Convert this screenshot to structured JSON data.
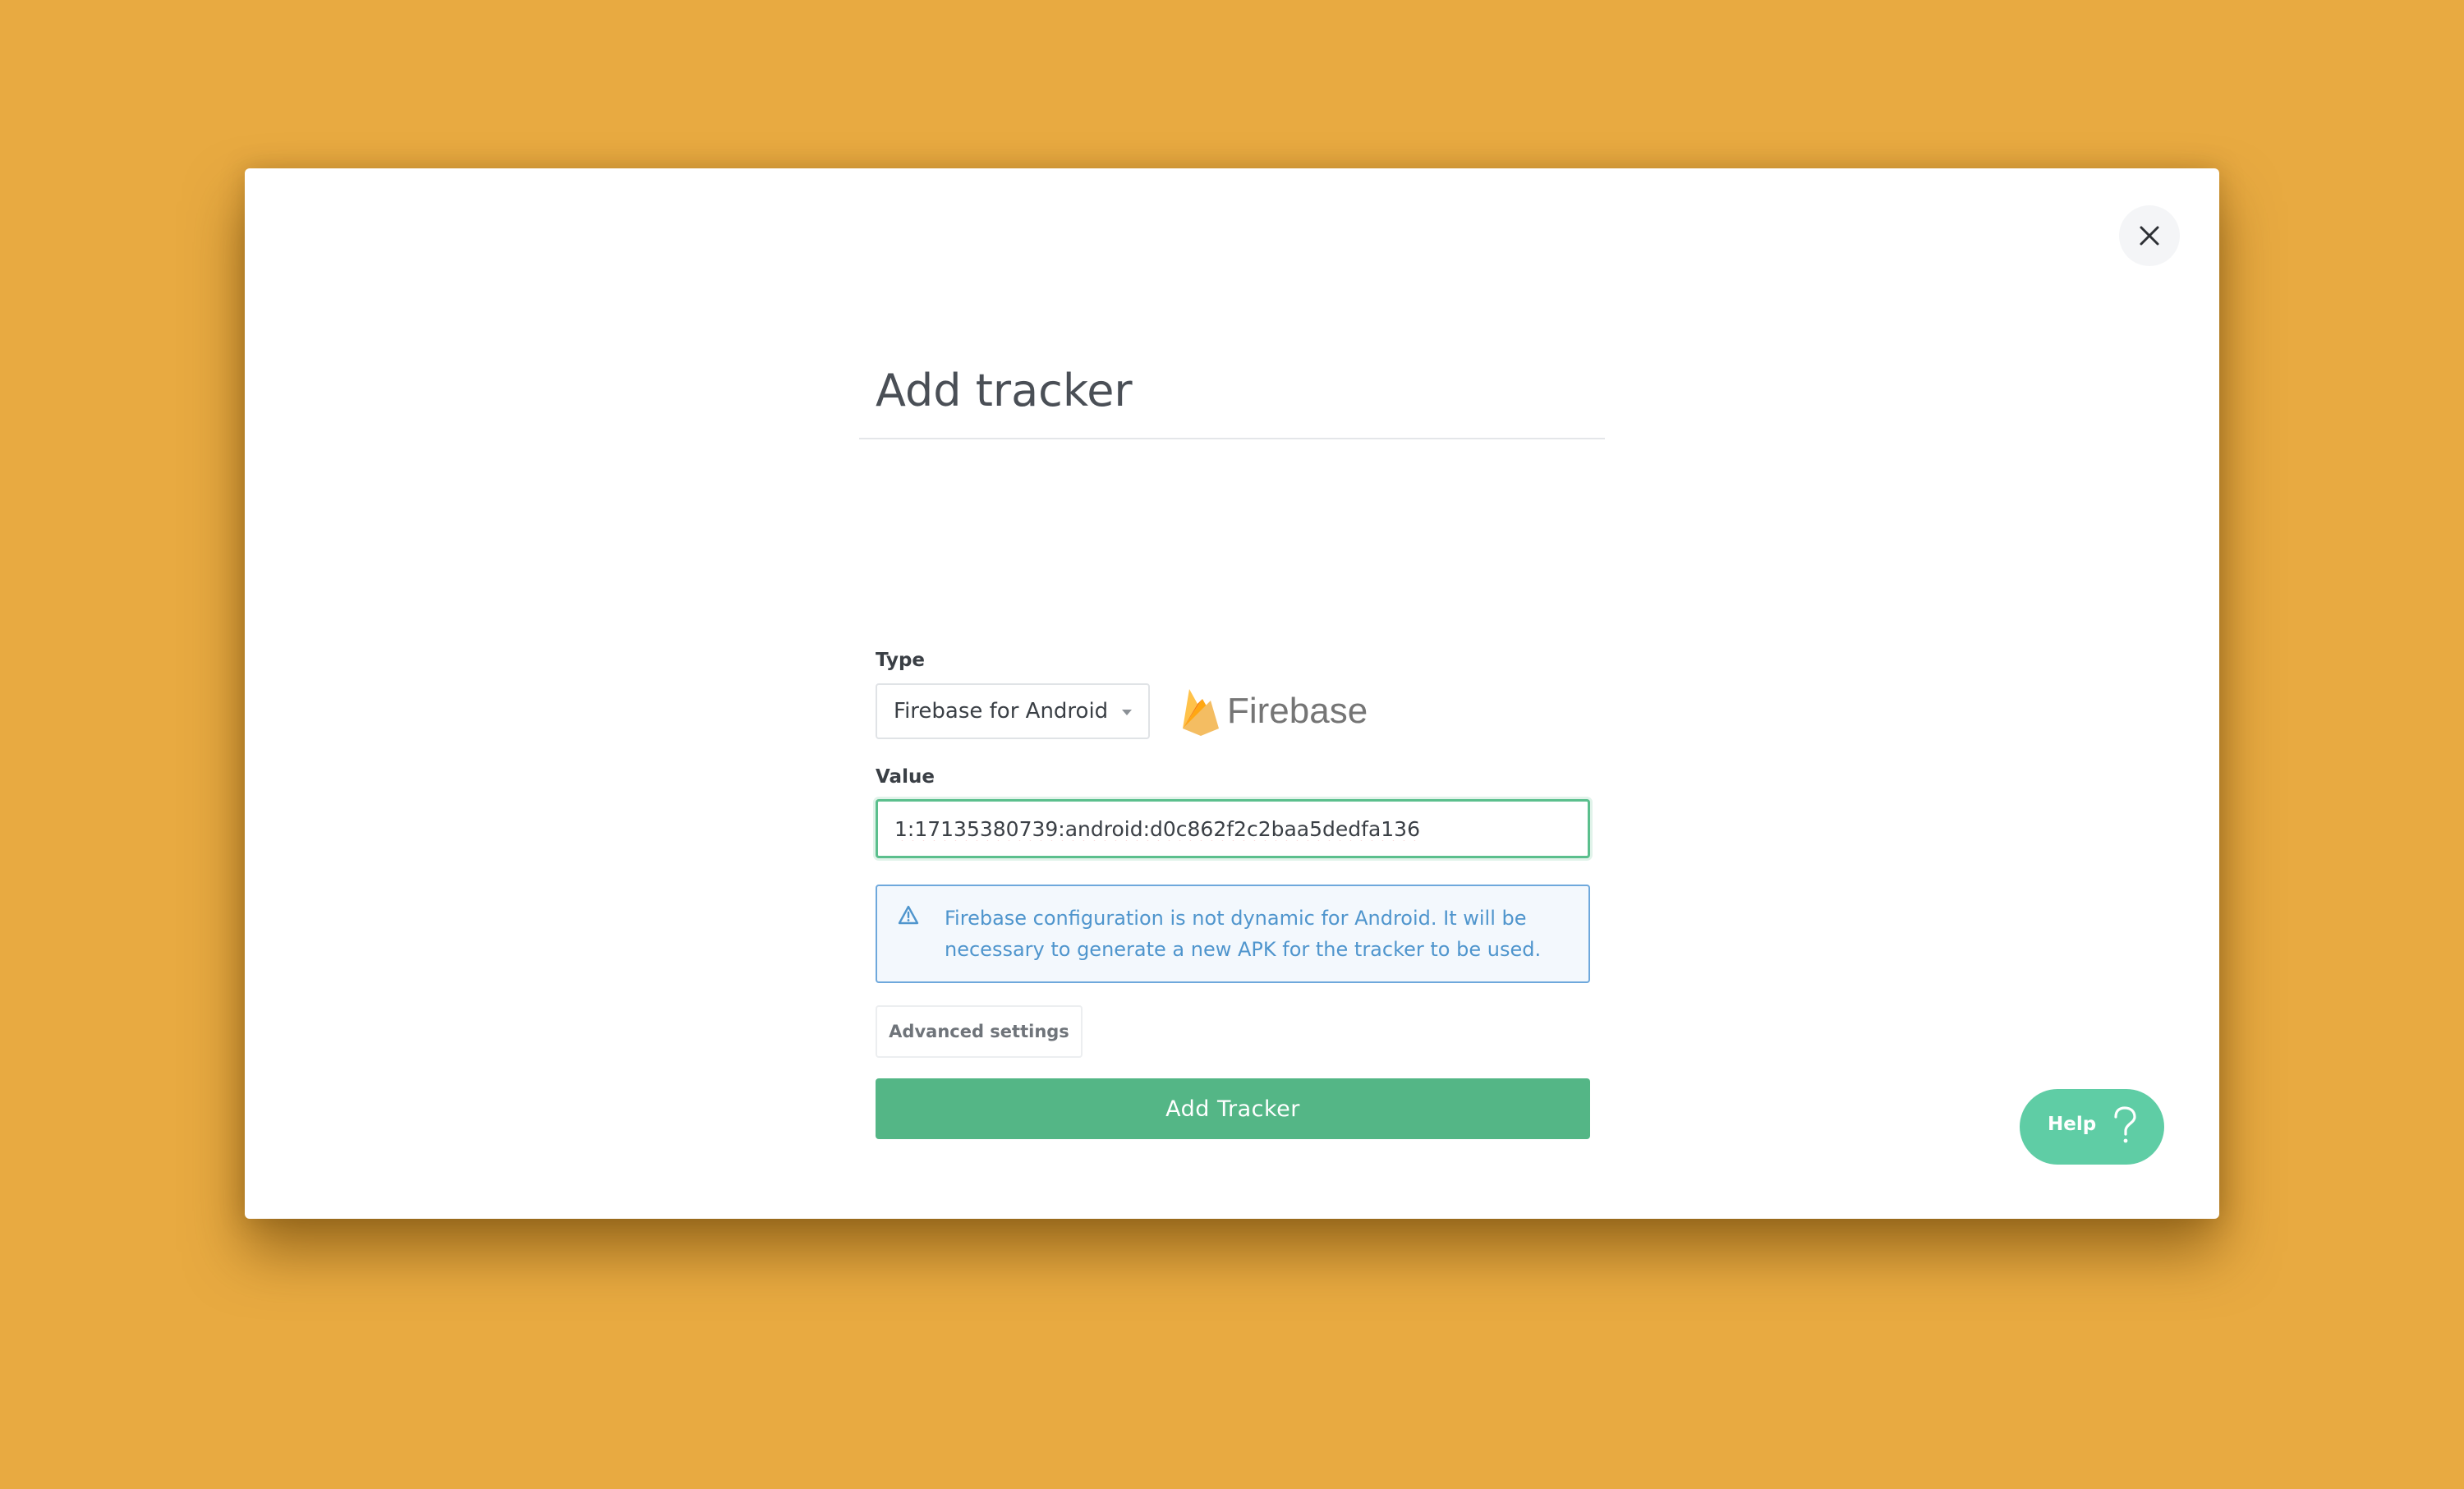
{
  "modal": {
    "title": "Add tracker",
    "close_icon": "close-icon"
  },
  "form": {
    "type_label": "Type",
    "type_selected": "Firebase for Android",
    "logo_text": "Firebase",
    "logo_icon": "firebase-flame-icon",
    "value_label": "Value",
    "value": "1:17135380739:android:d0c862f2c2baa5dedfa136"
  },
  "alert": {
    "icon": "warning-triangle-icon",
    "text": "Firebase configuration is not dynamic for Android. It will be necessary to generate a new APK for the tracker to be used."
  },
  "buttons": {
    "advanced_settings": "Advanced settings",
    "add_tracker": "Add Tracker"
  },
  "help": {
    "label": "Help",
    "icon": "question-mark-icon"
  },
  "colors": {
    "background": "#E8AA41",
    "primary": "#54B686",
    "help": "#5FCDA5",
    "info": "#4F95CD"
  }
}
